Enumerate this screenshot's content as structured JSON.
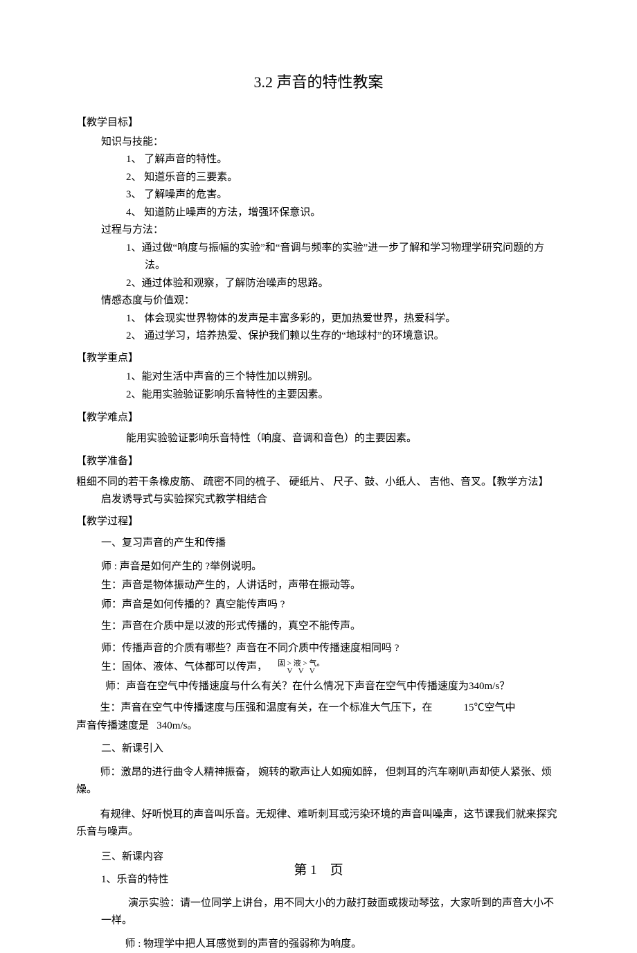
{
  "title": "3.2 声音的特性教案",
  "h_objective": "【教学目标】",
  "h_knowledge": "知识与技能：",
  "k1": "1、 了解声音的特性。",
  "k2": "2、 知道乐音的三要素。",
  "k3": "3、 了解噪声的危害。",
  "k4": "4、 知道防止噪声的方法，增强环保意识。",
  "h_process": "过程与方法：",
  "p1": "1、通过做“响度与振幅的实验”和“音调与频率的实验”进一步了解和学习物理学研究问题的方法。",
  "p2": "2、通过体验和观察，了解防治噪声的思路。",
  "h_emotion": "情感态度与价值观：",
  "e1": "1、 体会现实世界物体的发声是丰富多彩的，更加热爱世界，热爱科学。",
  "e2": "2、 通过学习，培养热爱、保护我们赖以生存的“地球村”的环境意识。",
  "h_focal": "【教学重点】",
  "f1": "1、能对生活中声音的三个特性加以辨别。",
  "f2": "2、能用实验验证影响乐音特性的主要因素。",
  "h_diff": "【教学难点】",
  "d1": "能用实验验证影响乐音特性（响度、音调和音色）的主要因素。",
  "h_prep": "【教学准备】",
  "prep_text": "粗细不同的若干条橡皮筋、 疏密不同的梳子、 硬纸片、 尺子、鼓、小纸人、 吉他、音叉。【教学方法】",
  "method_text": "启发诱导式与实验探究式教学相结合",
  "h_proc": "【教学过程】",
  "proc_1": "一、复习声音的产生和传播",
  "q1": "师 : 声音是如何产生的 ?举例说明。",
  "a1": "生：声音是物体振动产生的，人讲话时，声带在振动等。",
  "q2": "师：声音是如何传播的？真空能传声吗 ?",
  "a2": "生：声音在介质中是以波的形式传播的，真空不能传声。",
  "q3": "师：传播声音的介质有哪些？声音在不同介质中传播速度相同吗 ?",
  "a3_pre": "生：固体、液体、气体都可以传声，",
  "vel_top": "固 > 液 > 气。",
  "vel_bot": "V   V   V",
  "q4": "师：声音在空气中传播速度与什么有关？在什么情况下声音在空气中传播速度为340m/s？",
  "a4_pre": "生：声音在空气中传播速度与压强和温度有关，在一个标准大气压下，在",
  "a4_val": "15℃空气中",
  "a4_post": "声音传播速度是   340m/s。",
  "proc_2": "二、新课引入",
  "intro": "师：激昂的进行曲令人精神振奋， 婉转的歌声让人如痴如醉， 但刺耳的汽车喇叭声却使人紧张、烦燥。",
  "intro2": "有规律、好听悦耳的声音叫乐音。无规律、难听刺耳或污染环境的声音叫噪声，这节课我们就来探究乐音与噪声。",
  "proc_3": "三、新课内容",
  "c1": "1、乐音的特性",
  "exp": "演示实验：请一位同学上讲台，用不同大小的力敲打鼓面或拨动琴弦，大家听到的声音大小不一样。",
  "exp2": "师 : 物理学中把人耳感觉到的声音的强弱称为响度。",
  "footer": "第 1    页"
}
